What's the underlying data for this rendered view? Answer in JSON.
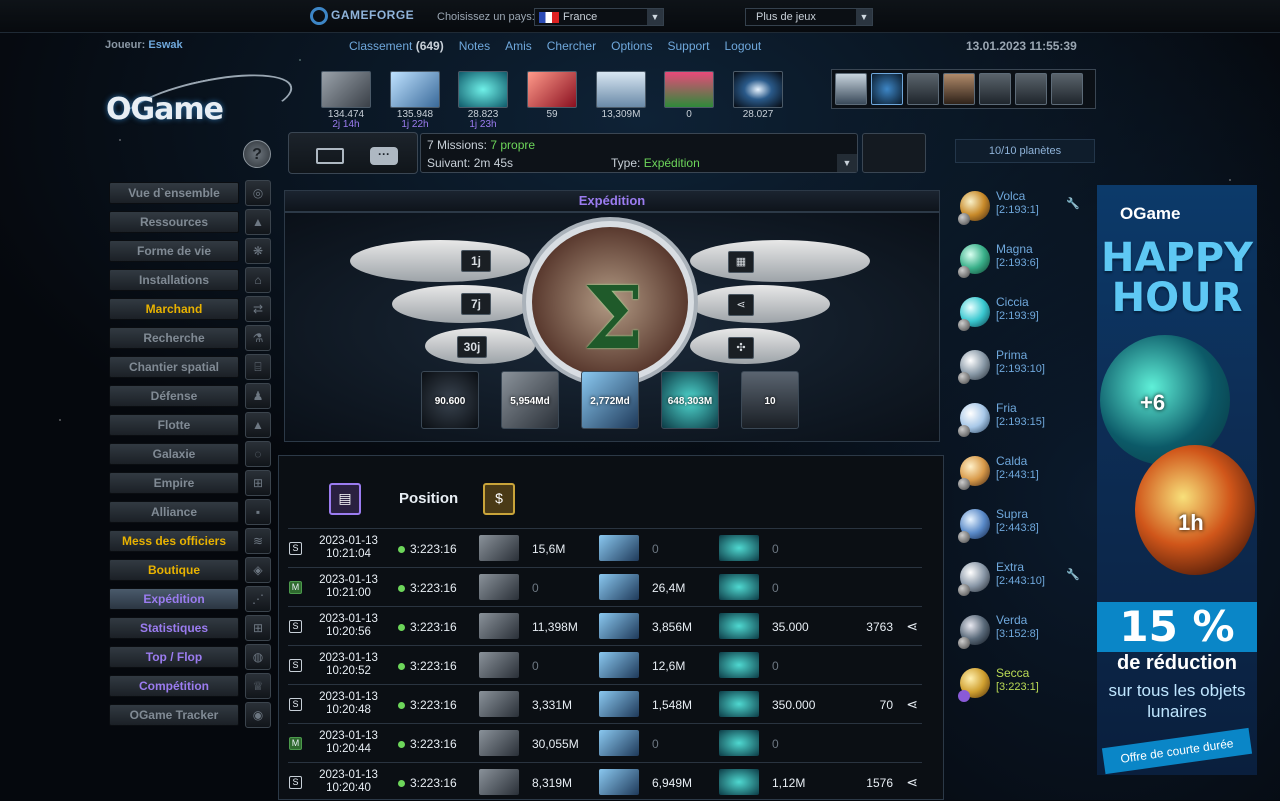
{
  "topbar": {
    "brand": "GAMEFORGE",
    "country_label": "Choisissez un pays:",
    "country_value": "France",
    "more_games": "Plus de jeux"
  },
  "header": {
    "player_label": "Joueur:",
    "player_name": "Eswak",
    "links": {
      "ranking": "Classement",
      "ranking_count": "(649)",
      "notes": "Notes",
      "friends": "Amis",
      "search": "Chercher",
      "options": "Options",
      "support": "Support",
      "logout": "Logout"
    },
    "datetime": "13.01.2023 11:55:39"
  },
  "logo": "OGame",
  "resources": [
    {
      "name": "metal",
      "value": "134.474",
      "sub": "2j 14h"
    },
    {
      "name": "crystal",
      "value": "135.948",
      "sub": "1j 22h"
    },
    {
      "name": "deuterium",
      "value": "28.823",
      "sub": "1j 23h"
    },
    {
      "name": "energy",
      "value": "59",
      "sub": ""
    },
    {
      "name": "population",
      "value": "13,309M",
      "sub": ""
    },
    {
      "name": "food",
      "value": "0",
      "sub": ""
    },
    {
      "name": "dark-matter",
      "value": "28.027",
      "sub": ""
    }
  ],
  "fleet_events": {
    "missions_label": "7 Missions:",
    "missions_own": "7 propre",
    "next_label": "Suivant:",
    "next_value": "2m 45s",
    "type_label": "Type:",
    "type_value": "Expédition"
  },
  "planet_count": "10/10 planètes",
  "menu": [
    {
      "label": "Vue d`ensemble",
      "style": ""
    },
    {
      "label": "Ressources",
      "style": ""
    },
    {
      "label": "Forme de vie",
      "style": ""
    },
    {
      "label": "Installations",
      "style": ""
    },
    {
      "label": "Marchand",
      "style": "gold"
    },
    {
      "label": "Recherche",
      "style": ""
    },
    {
      "label": "Chantier spatial",
      "style": ""
    },
    {
      "label": "Défense",
      "style": ""
    },
    {
      "label": "Flotte",
      "style": ""
    },
    {
      "label": "Galaxie",
      "style": ""
    },
    {
      "label": "Empire",
      "style": ""
    },
    {
      "label": "Alliance",
      "style": ""
    },
    {
      "label": "Mess des officiers",
      "style": "gold"
    },
    {
      "label": "Boutique",
      "style": "gold"
    },
    {
      "label": "Expédition",
      "style": "active"
    },
    {
      "label": "Statistiques",
      "style": "purple"
    },
    {
      "label": "Top / Flop",
      "style": "purple"
    },
    {
      "label": "Compétition",
      "style": "purple"
    },
    {
      "label": "OGame Tracker",
      "style": ""
    }
  ],
  "expedition": {
    "title": "Expédition",
    "periods": [
      "1j",
      "7j",
      "30j"
    ],
    "stats": [
      "90.600",
      "5,954Md",
      "2,772Md",
      "648,303M",
      "10"
    ]
  },
  "table": {
    "position_header": "Position",
    "rows": [
      {
        "badge": "S",
        "date": "2023-01-13",
        "time": "10:21:04",
        "pos": "3:223:16",
        "metal": "15,6M",
        "crystal": "0",
        "deut": "0",
        "extra": "",
        "count": ""
      },
      {
        "badge": "M",
        "date": "2023-01-13",
        "time": "10:21:00",
        "pos": "3:223:16",
        "metal": "0",
        "crystal": "26,4M",
        "deut": "0",
        "extra": "",
        "count": ""
      },
      {
        "badge": "S",
        "date": "2023-01-13",
        "time": "10:20:56",
        "pos": "3:223:16",
        "metal": "11,398M",
        "crystal": "3,856M",
        "deut": "35.000",
        "extra": "",
        "count": "3763"
      },
      {
        "badge": "S",
        "date": "2023-01-13",
        "time": "10:20:52",
        "pos": "3:223:16",
        "metal": "0",
        "crystal": "12,6M",
        "deut": "0",
        "extra": "",
        "count": ""
      },
      {
        "badge": "S",
        "date": "2023-01-13",
        "time": "10:20:48",
        "pos": "3:223:16",
        "metal": "3,331M",
        "crystal": "1,548M",
        "deut": "350.000",
        "extra": "",
        "count": "70"
      },
      {
        "badge": "M",
        "date": "2023-01-13",
        "time": "10:20:44",
        "pos": "3:223:16",
        "metal": "30,055M",
        "crystal": "0",
        "deut": "0",
        "extra": "",
        "count": ""
      },
      {
        "badge": "S",
        "date": "2023-01-13",
        "time": "10:20:40",
        "pos": "3:223:16",
        "metal": "8,319M",
        "crystal": "6,949M",
        "deut": "1,12M",
        "extra": "",
        "count": "1576"
      }
    ]
  },
  "planets": [
    {
      "name": "Volca",
      "coords": "[2:193:1]",
      "wrench": "🔧"
    },
    {
      "name": "Magna",
      "coords": "[2:193:6]",
      "wrench": ""
    },
    {
      "name": "Ciccia",
      "coords": "[2:193:9]",
      "wrench": ""
    },
    {
      "name": "Prima",
      "coords": "[2:193:10]",
      "wrench": ""
    },
    {
      "name": "Fria",
      "coords": "[2:193:15]",
      "wrench": ""
    },
    {
      "name": "Calda",
      "coords": "[2:443:1]",
      "wrench": ""
    },
    {
      "name": "Supra",
      "coords": "[2:443:8]",
      "wrench": ""
    },
    {
      "name": "Extra",
      "coords": "[2:443:10]",
      "wrench": "🔧"
    },
    {
      "name": "Verda",
      "coords": "[3:152:8]",
      "wrench": ""
    },
    {
      "name": "Secca",
      "coords": "[3:223:1]",
      "wrench": ""
    }
  ],
  "ad": {
    "logo": "OGame",
    "headline": "HAPPY HOUR",
    "badge1": "+6",
    "badge2": "1h",
    "percent": "15 %",
    "reduction": "de réduction",
    "desc": "sur tous les objets lunaires",
    "offer": "Offre de courte durée"
  },
  "colors": {
    "link": "#6fa8dc",
    "gold": "#e8b200",
    "purple": "#9b7cf0",
    "green": "#6dd65a"
  }
}
